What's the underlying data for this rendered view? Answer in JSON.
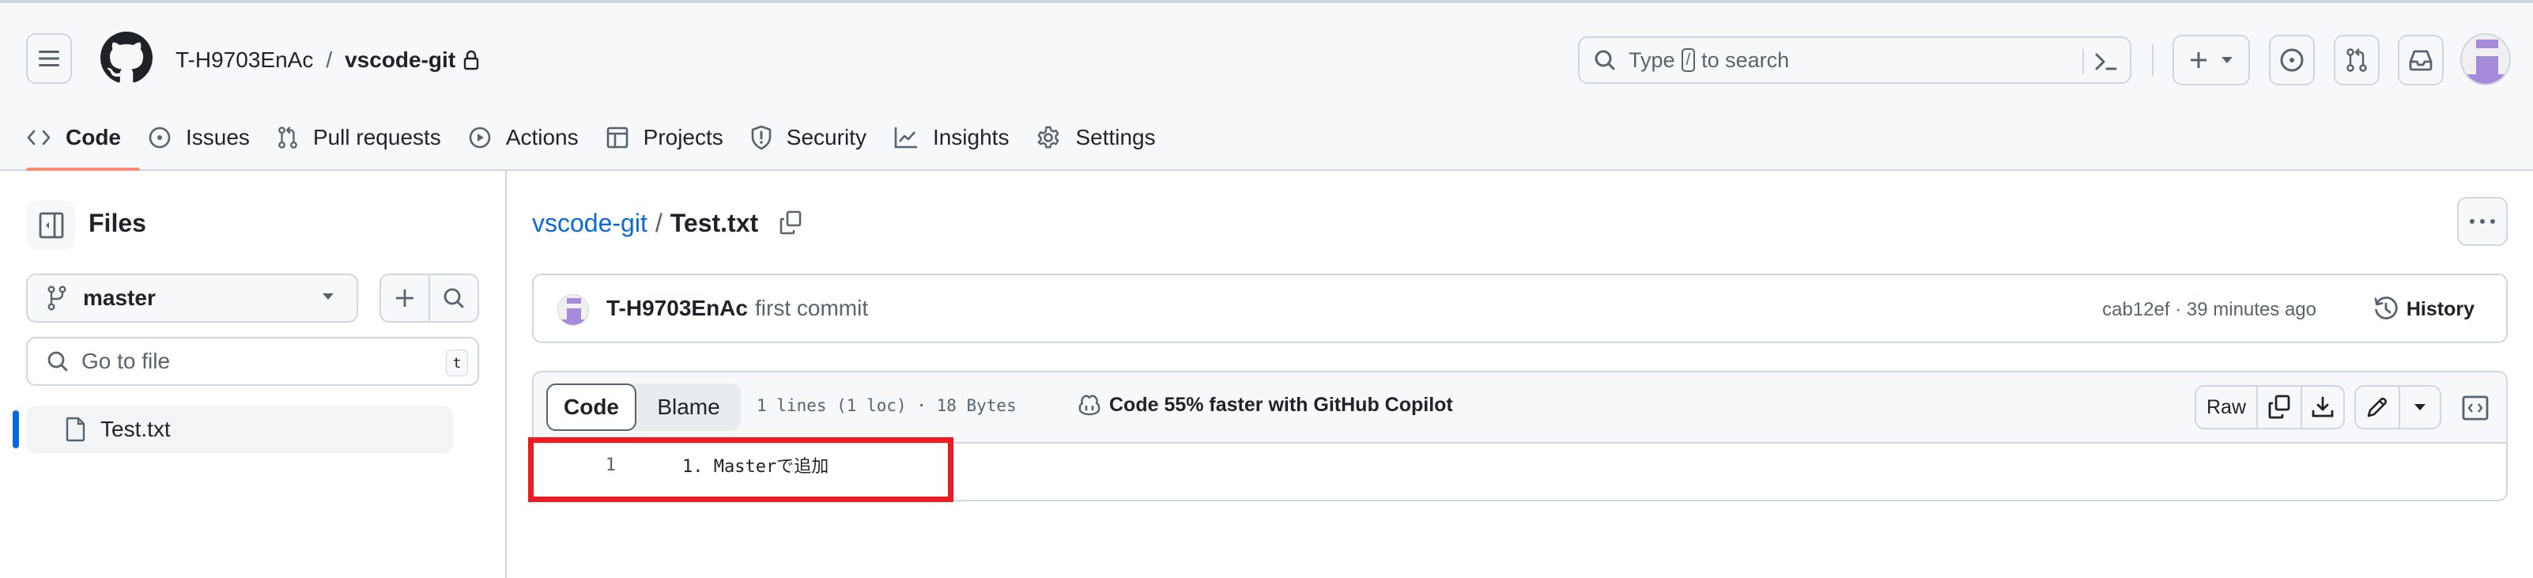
{
  "header": {
    "owner": "T-H9703EnAc",
    "separator": "/",
    "repo": "vscode-git",
    "repo_visibility_icon": "lock-icon",
    "search": {
      "placeholder_before": "Type",
      "placeholder_key": "/",
      "placeholder_after": "to search"
    },
    "avatar_color": "#a58cdb"
  },
  "tabs": [
    {
      "label": "Code",
      "icon": "code-icon",
      "active": true
    },
    {
      "label": "Issues",
      "icon": "issue-opened-icon",
      "active": false
    },
    {
      "label": "Pull requests",
      "icon": "git-pull-request-icon",
      "active": false
    },
    {
      "label": "Actions",
      "icon": "play-icon",
      "active": false
    },
    {
      "label": "Projects",
      "icon": "table-icon",
      "active": false
    },
    {
      "label": "Security",
      "icon": "shield-icon",
      "active": false
    },
    {
      "label": "Insights",
      "icon": "graph-icon",
      "active": false
    },
    {
      "label": "Settings",
      "icon": "gear-icon",
      "active": false
    }
  ],
  "sidebar": {
    "title": "Files",
    "branch": "master",
    "goto_placeholder": "Go to file",
    "goto_shortcut": "t",
    "files": [
      {
        "name": "Test.txt",
        "selected": true
      }
    ]
  },
  "main": {
    "breadcrumb": {
      "repo_link": "vscode-git",
      "separator": "/",
      "file": "Test.txt"
    },
    "commit": {
      "author": "T-H9703EnAc",
      "message": "first commit",
      "meta": "cab12ef · 39 minutes ago",
      "history_label": "History"
    },
    "file_view": {
      "tab_code": "Code",
      "tab_blame": "Blame",
      "info": "1 lines (1 loc) · 18 Bytes",
      "copilot_promo": "Code 55% faster with GitHub Copilot",
      "raw_label": "Raw",
      "lines": [
        {
          "number": "1",
          "text": "1. Masterで追加"
        }
      ]
    }
  },
  "annotation": {
    "highlight_color": "#ed1c24"
  },
  "colors": {
    "accent_link": "#0969da",
    "tab_underline": "#fd8c73",
    "border": "#d0d7de",
    "muted_text": "#59636e"
  }
}
